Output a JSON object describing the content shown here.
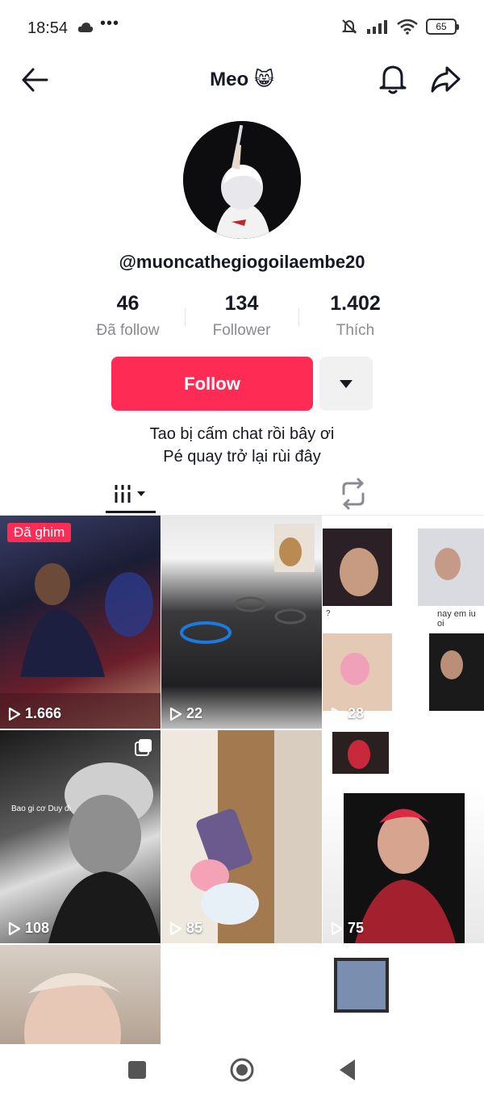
{
  "status_bar": {
    "time": "18:54",
    "dots": "•••",
    "battery": "65",
    "icons": [
      "cloud-icon",
      "mute-icon",
      "signal-icon",
      "wifi-icon",
      "battery-icon"
    ]
  },
  "header": {
    "title": "Meo",
    "title_emoji": "😸",
    "icons": [
      "back-arrow-icon",
      "bell-icon",
      "share-icon"
    ]
  },
  "profile": {
    "username": "@muoncathegiogoilaembe20",
    "stats": [
      {
        "value": "46",
        "label": "Đã follow"
      },
      {
        "value": "134",
        "label": "Follower"
      },
      {
        "value": "1.402",
        "label": "Thích"
      }
    ],
    "follow_label": "Follow",
    "bio_line1": "Tao bị cấm chat rồi bây ơi",
    "bio_line2": "Pé quay trở lại rùi đây"
  },
  "tabs": [
    {
      "name": "videos",
      "icon": "grid-icon",
      "active": true
    },
    {
      "name": "reposts",
      "icon": "repost-icon",
      "active": false
    }
  ],
  "videos": [
    {
      "views": "1.666",
      "pinned_label": "Đã ghim"
    },
    {
      "views": "22"
    },
    {
      "views": "28",
      "caption_left": "?",
      "caption_right": "nay em iu oi"
    },
    {
      "views": "108",
      "caption": "Bao gi cơ Duy đi"
    },
    {
      "views": "85"
    },
    {
      "views": "75"
    },
    {
      "views": ""
    },
    {
      "views": ""
    },
    {
      "views": ""
    }
  ],
  "colors": {
    "accent": "#fe2c55",
    "text": "#161823",
    "muted": "#8a8b91"
  }
}
